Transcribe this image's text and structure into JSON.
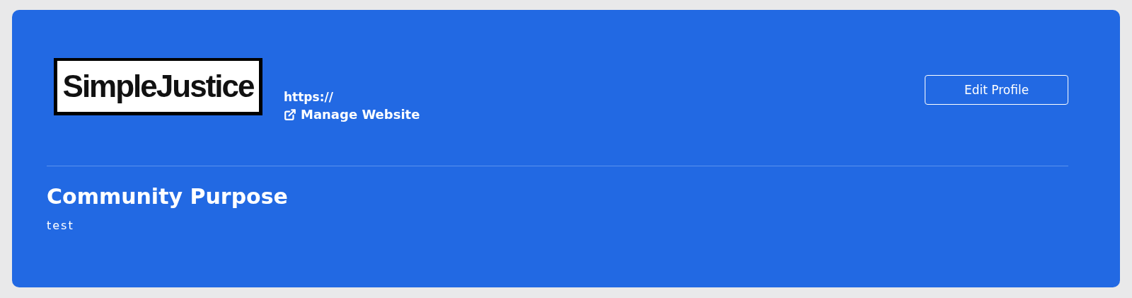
{
  "profile": {
    "logo_text": "SimpleJustice",
    "url": "https://",
    "manage_link": "Manage Website",
    "edit_button": "Edit Profile"
  },
  "purpose": {
    "title": "Community Purpose",
    "text": "test"
  }
}
